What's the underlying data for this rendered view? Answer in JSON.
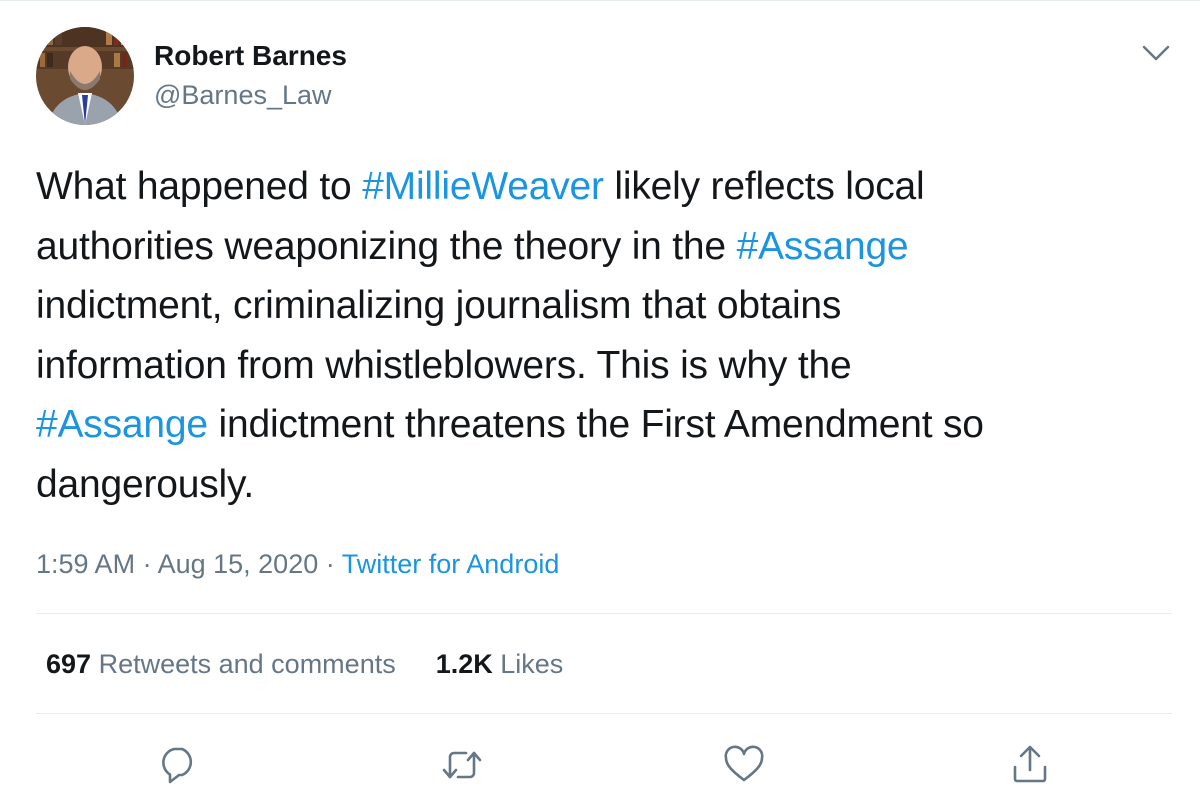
{
  "author": {
    "display_name": "Robert Barnes",
    "handle": "@Barnes_Law"
  },
  "tweet": {
    "lines": [
      [
        {
          "text": "What happened to ",
          "hashtag": false
        },
        {
          "text": "#MillieWeaver",
          "hashtag": true
        },
        {
          "text": " likely reflects local",
          "hashtag": false
        }
      ],
      [
        {
          "text": "authorities weaponizing the theory in the ",
          "hashtag": false
        },
        {
          "text": "#Assange",
          "hashtag": true
        }
      ],
      [
        {
          "text": "indictment, criminalizing journalism that obtains",
          "hashtag": false
        }
      ],
      [
        {
          "text": "information from whistleblowers. This is why the",
          "hashtag": false
        }
      ],
      [
        {
          "text": "#Assange",
          "hashtag": true
        },
        {
          "text": " indictment threatens the First Amendment so",
          "hashtag": false
        }
      ],
      [
        {
          "text": "dangerously.",
          "hashtag": false
        }
      ]
    ]
  },
  "meta": {
    "time": "1:59 AM",
    "separator": " · ",
    "date": "Aug 15, 2020",
    "source": "Twitter for Android"
  },
  "stats": {
    "retweets_count": "697",
    "retweets_label": "Retweets and comments",
    "likes_count": "1.2K",
    "likes_label": "Likes"
  },
  "actions": {
    "icons": [
      "reply-icon",
      "retweet-icon",
      "like-icon",
      "share-icon"
    ]
  },
  "colors": {
    "text": "#14171a",
    "secondary": "#657786",
    "link": "#1b95e0",
    "divider": "#e6ecf0"
  }
}
